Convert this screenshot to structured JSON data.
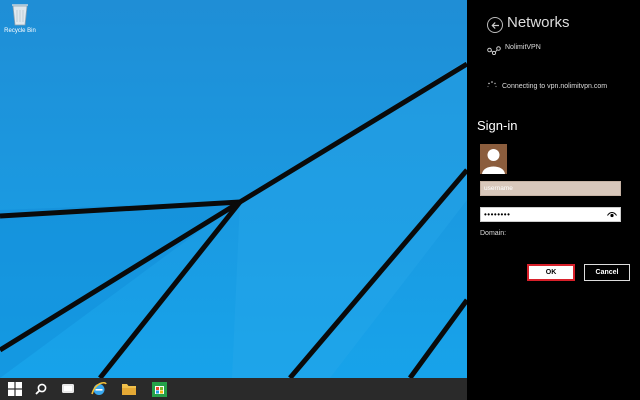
{
  "desktop": {
    "recycle_bin_label": "Recycle Bin",
    "background_color": "#1a9be6"
  },
  "taskbar": {
    "items": [
      {
        "name": "start-button",
        "icon": "windows-logo"
      },
      {
        "name": "search-button",
        "icon": "search-icon"
      },
      {
        "name": "task-view-button",
        "icon": "task-view-icon"
      },
      {
        "name": "internet-explorer-button",
        "icon": "ie-icon"
      },
      {
        "name": "file-explorer-button",
        "icon": "folder-icon"
      },
      {
        "name": "store-button",
        "icon": "store-icon"
      }
    ]
  },
  "networks_panel": {
    "title": "Networks",
    "vpn_name": "NolimitVPN",
    "connecting_text": "Connecting to vpn.nolimitvpn.com",
    "signin": {
      "title": "Sign-in",
      "username_placeholder": "username",
      "password_value": "••••••••",
      "domain_label": "Domain:",
      "ok_label": "OK",
      "cancel_label": "Cancel"
    },
    "colors": {
      "ok_border": "#d8202a",
      "username_bg": "#d8c7bb"
    }
  }
}
